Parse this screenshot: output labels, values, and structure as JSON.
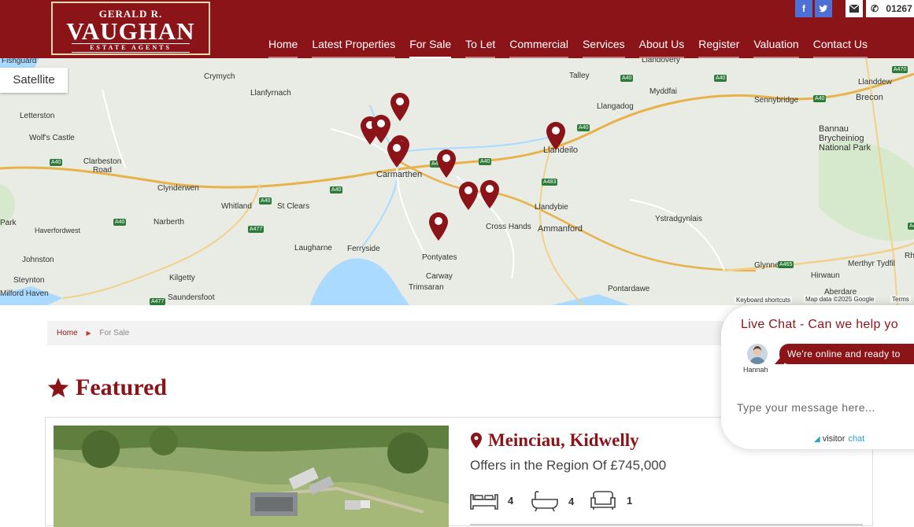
{
  "brand": {
    "logo_top": "GERALD R.",
    "logo_main": "VAUGHAN",
    "logo_sub": "ESTATE AGENTS",
    "primary_color": "#8b1419",
    "accent_color": "#4e6fd4"
  },
  "header": {
    "social": [
      {
        "icon": "facebook-icon",
        "glyph": "f"
      },
      {
        "icon": "twitter-icon",
        "glyph": "t"
      }
    ],
    "phone": "01267",
    "nav": [
      {
        "label": "Home",
        "active": false
      },
      {
        "label": "Latest Properties",
        "active": false
      },
      {
        "label": "For Sale",
        "active": true
      },
      {
        "label": "To Let",
        "active": false
      },
      {
        "label": "Commercial",
        "active": false
      },
      {
        "label": "Services",
        "active": false
      },
      {
        "label": "About Us",
        "active": false
      },
      {
        "label": "Register",
        "active": false
      },
      {
        "label": "Valuation",
        "active": false
      },
      {
        "label": "Contact Us",
        "active": false
      }
    ]
  },
  "map": {
    "satellite_label": "Satellite",
    "labels": [
      "Fishguard",
      "Crymych",
      "Llanfyrnach",
      "Letterston",
      "Wolf's Castle",
      "Clarbeston Road",
      "Clynderwen",
      "Narberth",
      "Whitland",
      "St Clears",
      "Carmarthen",
      "Laugharne",
      "Ferryside",
      "Kilgetty",
      "Saundersfoot",
      "Johnston",
      "Steynton",
      "Milford Haven",
      "Haverfordwest",
      "Park",
      "Pontyates",
      "Carway",
      "Trimsaran",
      "Cross Hands",
      "Ammanford",
      "Llandybie",
      "Llandeilo",
      "Llangadog",
      "Talley",
      "Myddfai",
      "Llandovery",
      "Sennybridge",
      "Brecon",
      "Llanddew",
      "Bannau Brycheiniog National Park",
      "Ystradgynlais",
      "Glynneath",
      "Hirwaun",
      "Merthyr Tydfil",
      "Aberdare",
      "Pontardawe",
      "Rh"
    ],
    "roads": [
      "A40",
      "A48",
      "A477",
      "A483",
      "A465",
      "A470",
      "A4"
    ],
    "footer": {
      "shortcuts": "Keyboard shortcuts",
      "data": "Map data ©2025 Google",
      "terms": "Terms"
    }
  },
  "breadcrumb": {
    "home": "Home",
    "current": "For Sale"
  },
  "featured": {
    "title": "Featured"
  },
  "listing": {
    "title": "Meinciau, Kidwelly",
    "price": "Offers in the Region Of £745,000",
    "bedrooms": "4",
    "bathrooms": "4",
    "receptions": "1"
  },
  "chat": {
    "title": "Live Chat - Can we help yo",
    "agent": "Hannah",
    "message": "We're online and ready to",
    "placeholder": "Type your message here...",
    "brand_a": "visitor",
    "brand_b": "chat"
  }
}
